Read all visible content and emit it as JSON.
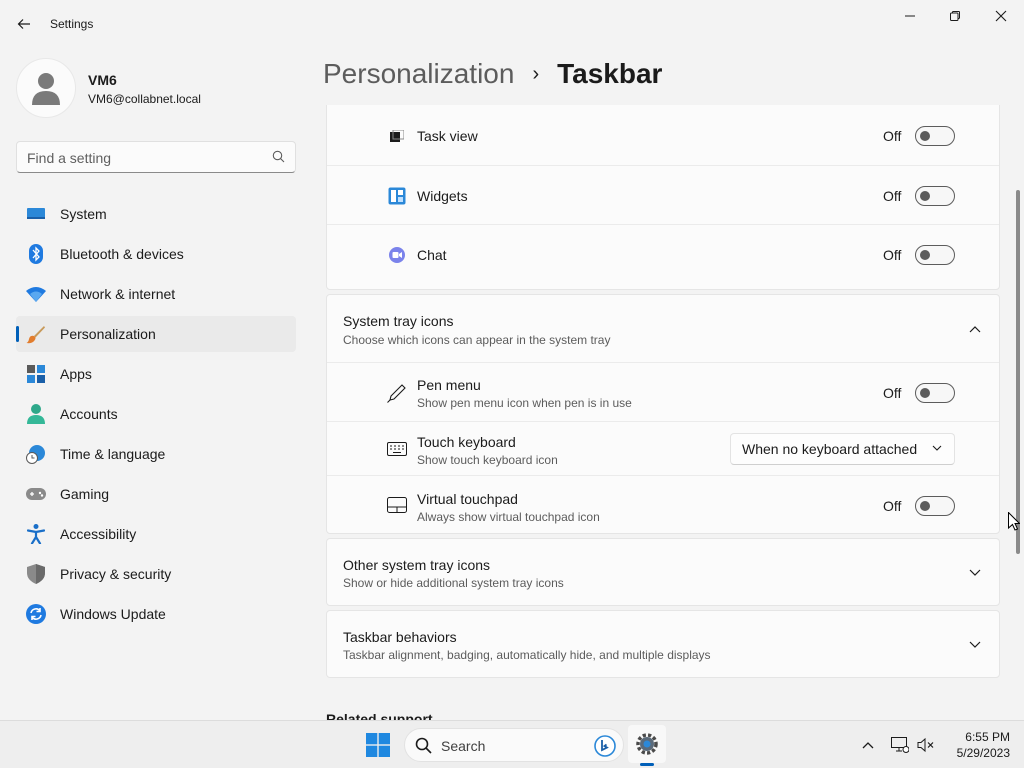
{
  "window": {
    "title": "Settings"
  },
  "user": {
    "name": "VM6",
    "email": "VM6@collabnet.local"
  },
  "search": {
    "placeholder": "Find a setting"
  },
  "nav": {
    "items": [
      {
        "label": "System",
        "icon": "monitor-icon"
      },
      {
        "label": "Bluetooth & devices",
        "icon": "bluetooth-icon"
      },
      {
        "label": "Network & internet",
        "icon": "wifi-icon"
      },
      {
        "label": "Personalization",
        "icon": "brush-icon",
        "active": true
      },
      {
        "label": "Apps",
        "icon": "apps-icon"
      },
      {
        "label": "Accounts",
        "icon": "person-icon"
      },
      {
        "label": "Time & language",
        "icon": "globe-clock-icon"
      },
      {
        "label": "Gaming",
        "icon": "gamepad-icon"
      },
      {
        "label": "Accessibility",
        "icon": "accessibility-icon"
      },
      {
        "label": "Privacy & security",
        "icon": "shield-icon"
      },
      {
        "label": "Windows Update",
        "icon": "update-icon"
      }
    ]
  },
  "header": {
    "parent": "Personalization",
    "separator": "›",
    "current": "Taskbar"
  },
  "taskbar_items": {
    "task_view": {
      "label": "Task view",
      "state": "Off"
    },
    "widgets": {
      "label": "Widgets",
      "state": "Off"
    },
    "chat": {
      "label": "Chat",
      "state": "Off"
    }
  },
  "system_tray": {
    "title": "System tray icons",
    "subtitle": "Choose which icons can appear in the system tray",
    "pen_menu": {
      "title": "Pen menu",
      "subtitle": "Show pen menu icon when pen is in use",
      "state": "Off"
    },
    "touch_keyboard": {
      "title": "Touch keyboard",
      "subtitle": "Show touch keyboard icon",
      "value": "When no keyboard attached"
    },
    "virtual_touchpad": {
      "title": "Virtual touchpad",
      "subtitle": "Always show virtual touchpad icon",
      "state": "Off"
    }
  },
  "other_tray": {
    "title": "Other system tray icons",
    "subtitle": "Show or hide additional system tray icons"
  },
  "behaviors": {
    "title": "Taskbar behaviors",
    "subtitle": "Taskbar alignment, badging, automatically hide, and multiple displays"
  },
  "related": {
    "title": "Related support"
  },
  "taskbar": {
    "search_label": "Search",
    "time": "6:55 PM",
    "date": "5/29/2023"
  },
  "colors": {
    "accent": "#005fb8",
    "background": "#f3f3f3",
    "card": "#fbfbfb"
  }
}
